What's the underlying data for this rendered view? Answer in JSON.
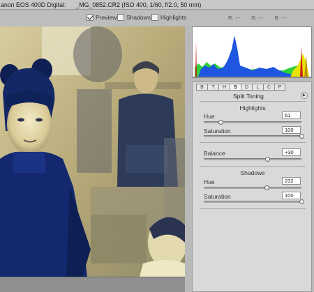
{
  "title": {
    "camera": "anon EOS 400D Digital:",
    "file": "_MG_0852.CR2  (ISO 400, 1/60, f/2.0, 50 mm)"
  },
  "toolbar": {
    "preview": {
      "label": "Preview",
      "checked": true
    },
    "shadows": {
      "label": "Shadows",
      "checked": false
    },
    "highlights": {
      "label": "Highlights",
      "checked": false
    },
    "readout": {
      "r": "R:  ---",
      "g": "G:  ---",
      "b": "B:  ---"
    }
  },
  "tabs": [
    "B",
    "T",
    "H",
    "S",
    "D",
    "L",
    "C",
    "P"
  ],
  "active_tab": "S",
  "panel": {
    "title": "Split Toning",
    "menu_icon": "play-circle-icon",
    "highlights": {
      "title": "Highlights",
      "hue": {
        "label": "Hue",
        "value": "61",
        "max": 360
      },
      "saturation": {
        "label": "Saturation",
        "value": "100",
        "max": 100
      }
    },
    "balance": {
      "label": "Balance",
      "value": "+30",
      "min": -100,
      "max": 100
    },
    "shadows": {
      "title": "Shadows",
      "hue": {
        "label": "Hue",
        "value": "232",
        "max": 360
      },
      "saturation": {
        "label": "Saturation",
        "value": "100",
        "max": 100
      }
    }
  },
  "colors": {
    "shadow_tone": "#1c3a8a",
    "highlight_tone": "#f0e6a8",
    "histogram_blue": "#1e56e0",
    "histogram_green": "#2fd13a",
    "histogram_yellow": "#e8e000",
    "histogram_red": "#d01818"
  }
}
